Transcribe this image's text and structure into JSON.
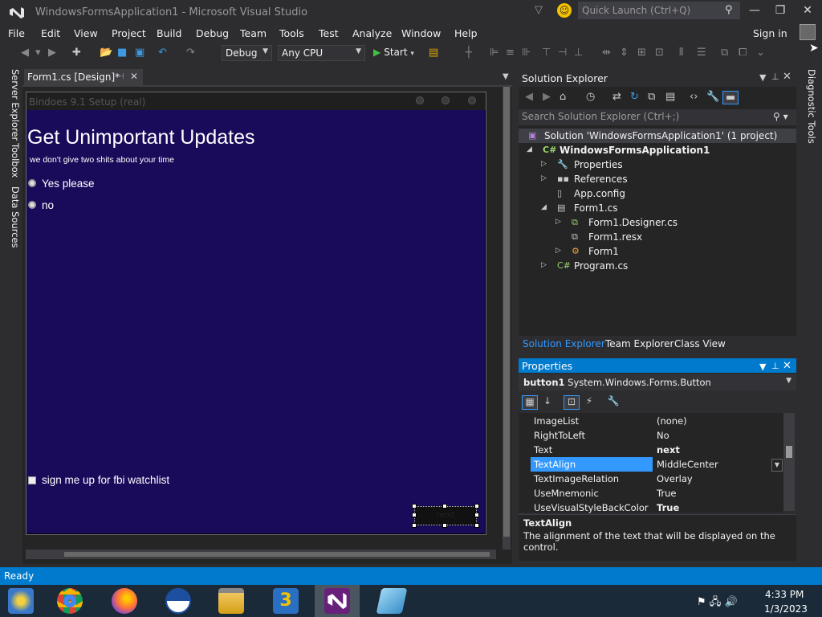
{
  "window": {
    "title": "WindowsFormsApplication1 - Microsoft Visual Studio"
  },
  "quick_launch": {
    "placeholder": "Quick Launch (Ctrl+Q)"
  },
  "menu": [
    "File",
    "Edit",
    "View",
    "Project",
    "Build",
    "Debug",
    "Team",
    "Tools",
    "Test",
    "Analyze",
    "Window",
    "Help"
  ],
  "signin_label": "Sign in",
  "toolbar": {
    "config": "Debug",
    "platform": "Any CPU",
    "start_label": "Start"
  },
  "left_tabs": [
    "Server Explorer",
    "Toolbox",
    "Data Sources"
  ],
  "document_tab": {
    "label": "Form1.cs [Design]*"
  },
  "form": {
    "title": "Bindoes 9.1 Setup (real)",
    "heading": "Get Unimportant Updates",
    "subheading": "we don't give two shits about your time",
    "radio_options": [
      "Yes please",
      "no"
    ],
    "checkbox_label": "sign me up for fbi watchlist",
    "button_text": "next",
    "background": "#1a0a5a"
  },
  "solution_explorer": {
    "title": "Solution Explorer",
    "search_placeholder": "Search Solution Explorer (Ctrl+;)",
    "tree": [
      {
        "label": "Solution 'WindowsFormsApplication1' (1 project)"
      },
      {
        "label": "WindowsFormsApplication1"
      },
      {
        "label": "Properties"
      },
      {
        "label": "References"
      },
      {
        "label": "App.config"
      },
      {
        "label": "Form1.cs"
      },
      {
        "label": "Form1.Designer.cs"
      },
      {
        "label": "Form1.resx"
      },
      {
        "label": "Form1"
      },
      {
        "label": "Program.cs"
      }
    ],
    "tabs": [
      "Solution Explorer",
      "Team Explorer",
      "Class View"
    ]
  },
  "properties": {
    "title": "Properties",
    "object_name": "button1",
    "object_type": "System.Windows.Forms.Button",
    "rows": [
      {
        "name": "ImageList",
        "value": "(none)"
      },
      {
        "name": "RightToLeft",
        "value": "No"
      },
      {
        "name": "Text",
        "value": "next"
      },
      {
        "name": "TextAlign",
        "value": "MiddleCenter"
      },
      {
        "name": "TextImageRelation",
        "value": "Overlay"
      },
      {
        "name": "UseMnemonic",
        "value": "True"
      },
      {
        "name": "UseVisualStyleBackColor",
        "value": "True"
      }
    ],
    "description_title": "TextAlign",
    "description_text": "The alignment of the text that will be displayed on the control."
  },
  "diagnostic_tab": "Diagnostic Tools",
  "status": "Ready",
  "clock": {
    "time": "4:33 PM",
    "date": "1/3/2023"
  },
  "colors": {
    "accent": "#007acc",
    "ide_bg": "#2d2d30",
    "selection": "#3399ff"
  }
}
